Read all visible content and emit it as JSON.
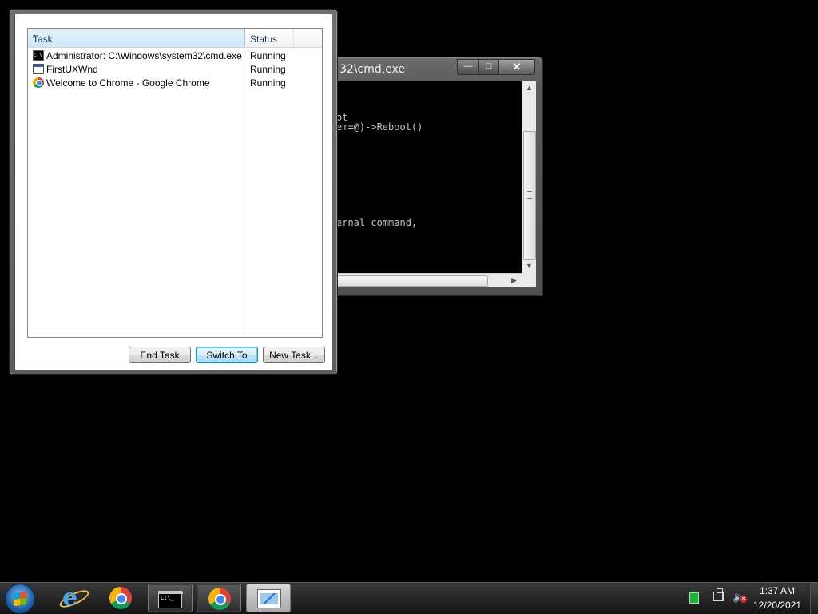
{
  "cmd_window": {
    "title": "32\\cmd.exe",
    "minimize": "—",
    "maximize": "□",
    "close": "✕",
    "lines": [
      "ot",
      "em=@)->Reboot()",
      "ernal command,"
    ],
    "scroll_up": "▲",
    "scroll_down": "▼",
    "scroll_right": "▶"
  },
  "task_manager": {
    "columns": {
      "task": "Task",
      "status": "Status",
      "sort_indicator": "^"
    },
    "rows": [
      {
        "name": "Administrator: C:\\Windows\\system32\\cmd.exe",
        "status": "Running",
        "icon": "cmd-icon"
      },
      {
        "name": "FirstUXWnd",
        "status": "Running",
        "icon": "window-icon"
      },
      {
        "name": "Welcome to Chrome - Google Chrome",
        "status": "Running",
        "icon": "chrome-icon"
      }
    ],
    "buttons": {
      "end_task": "End Task",
      "switch_to": "Switch To",
      "new_task": "New Task..."
    }
  },
  "taskbar": {
    "items": [
      {
        "name": "start-button",
        "icon": "windows-logo-icon"
      },
      {
        "name": "internet-explorer",
        "icon": "ie-icon",
        "glyph": "e"
      },
      {
        "name": "google-chrome",
        "icon": "chrome-icon"
      },
      {
        "name": "command-prompt",
        "icon": "cmd-icon",
        "glyph": "C:\\_"
      },
      {
        "name": "google-chrome-running",
        "icon": "chrome-icon"
      },
      {
        "name": "task-manager",
        "icon": "task-manager-icon"
      }
    ],
    "tray": {
      "volume_glyph": "🔈",
      "volume_muted": "×"
    },
    "clock": {
      "time": "1:37 AM",
      "date": "12/20/2021"
    }
  },
  "colors": {
    "desktop": "#000000",
    "selection_header": "#cde8f7",
    "switch_button_border": "#3c7fb1",
    "battery": "#19b33a"
  }
}
